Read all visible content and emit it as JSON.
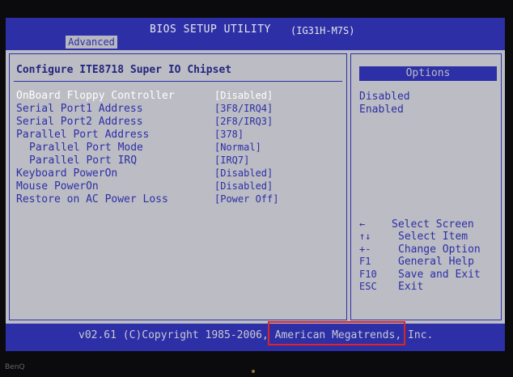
{
  "title_bar": {
    "title": "BIOS SETUP UTILITY",
    "model": "(IG31H-M7S)",
    "active_tab": "Advanced"
  },
  "section_title": "Configure ITE8718 Super IO Chipset",
  "settings": [
    {
      "label": "OnBoard Floppy Controller",
      "value": "[Disabled]"
    },
    {
      "label": "Serial Port1 Address",
      "value": "[3F8/IRQ4]"
    },
    {
      "label": "Serial Port2 Address",
      "value": "[2F8/IRQ3]"
    },
    {
      "label": "Parallel Port Address",
      "value": "[378]"
    },
    {
      "label": "Parallel Port Mode",
      "value": "[Normal]"
    },
    {
      "label": "Parallel Port IRQ",
      "value": "[IRQ7]"
    },
    {
      "label": "Keyboard PowerOn",
      "value": "[Disabled]"
    },
    {
      "label": "Mouse PowerOn",
      "value": "[Disabled]"
    },
    {
      "label": "Restore on AC Power Loss",
      "value": "[Power Off]"
    }
  ],
  "selected_index": 0,
  "options_panel": {
    "header": "Options",
    "items": [
      "Disabled",
      "Enabled"
    ]
  },
  "help": [
    {
      "key": "←",
      "desc": "Select Screen"
    },
    {
      "key": "↑↓",
      "desc": "Select Item"
    },
    {
      "key": "+-",
      "desc": "Change Option"
    },
    {
      "key": "F1",
      "desc": "General Help"
    },
    {
      "key": "F10",
      "desc": "Save and Exit"
    },
    {
      "key": "ESC",
      "desc": "Exit"
    }
  ],
  "footer": {
    "copyright": "v02.61 (C)Copyright 1985-2006, American Megatrends, Inc."
  },
  "bezel_brand": "BenQ",
  "colors": {
    "bios_blue": "#2c2fa6",
    "panel_gray": "#bcbcc4",
    "highlight_red": "#e02424"
  }
}
